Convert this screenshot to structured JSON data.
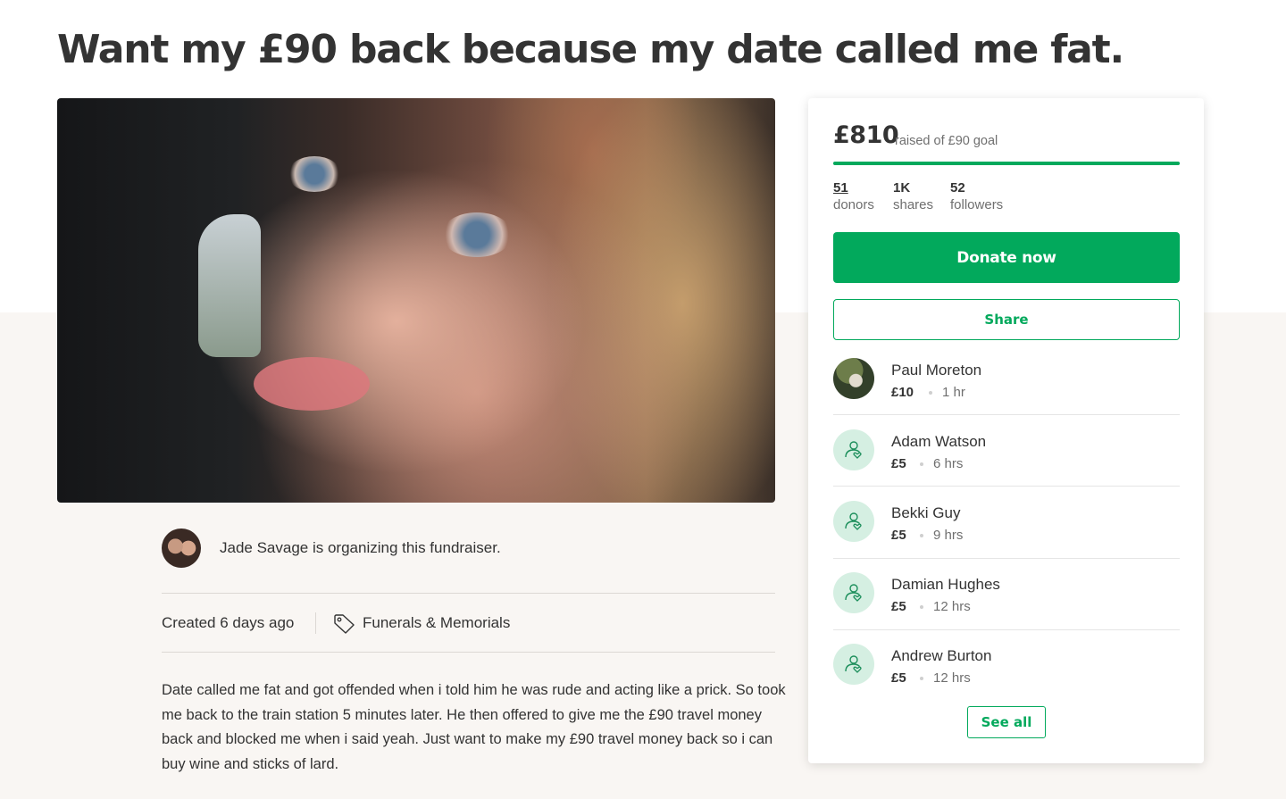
{
  "campaign": {
    "title": "Want my £90 back because my date called me fat.",
    "organizer_text": "Jade Savage is organizing this fundraiser.",
    "created": "Created 6 days ago",
    "category": "Funerals & Memorials",
    "story": "Date called me fat and got offended when i told him he was rude and acting like a prick. So took me back to the train station 5 minutes later. He then offered to give me the £90 travel money back and blocked me when i said yeah. Just want to make my £90 travel money back so i can buy wine and sticks of lard."
  },
  "progress": {
    "raised": "£810",
    "label": "raised of £90 goal",
    "fraction": 1.0
  },
  "stats": [
    {
      "value": "51",
      "label": "donors"
    },
    {
      "value": "1K",
      "label": "shares"
    },
    {
      "value": "52",
      "label": "followers"
    }
  ],
  "buttons": {
    "donate": "Donate now",
    "share": "Share",
    "see_all": "See all"
  },
  "donors": [
    {
      "name": "Paul Moreton",
      "amount": "£10",
      "time": "1 hr",
      "avatar": "photo"
    },
    {
      "name": "Adam Watson",
      "amount": "£5",
      "time": "6 hrs",
      "avatar": "donor-heart-icon"
    },
    {
      "name": "Bekki Guy",
      "amount": "£5",
      "time": "9 hrs",
      "avatar": "donor-heart-icon"
    },
    {
      "name": "Damian Hughes",
      "amount": "£5",
      "time": "12 hrs",
      "avatar": "donor-heart-icon"
    },
    {
      "name": "Andrew Burton",
      "amount": "£5",
      "time": "12 hrs",
      "avatar": "donor-heart-icon"
    }
  ],
  "colors": {
    "brand_green": "#02a95c",
    "avatar_bg": "#d5efe2",
    "lower_bg": "#f9f6f3"
  }
}
